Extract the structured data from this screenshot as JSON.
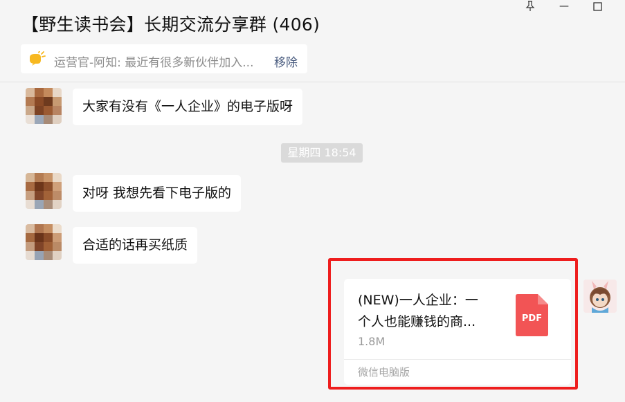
{
  "window": {
    "title": "【野生读书会】长期交流分享群 (406)",
    "controls": {
      "pin_icon": "pin-icon",
      "minimize_glyph": "—",
      "maximize_glyph": "☐"
    }
  },
  "notice": {
    "icon": "announcement-icon",
    "text": "运营官-阿知: 最近有很多新伙伴加入...",
    "action": "移除"
  },
  "messages": [
    {
      "type": "text",
      "from": "other",
      "text": "大家有没有《一人企业》的电子版呀"
    },
    {
      "type": "time",
      "text": "星期四 18:54"
    },
    {
      "type": "text",
      "from": "other",
      "text": "对呀 我想先看下电子版的"
    },
    {
      "type": "text",
      "from": "other",
      "text": "合适的话再买纸质"
    },
    {
      "type": "file",
      "from": "self",
      "name_line1": "(NEW)一人企业：一",
      "name_line2": "个人也能赚钱的商...",
      "size": "1.8M",
      "file_type": "PDF",
      "source": "微信电脑版"
    }
  ],
  "colors": {
    "background": "#f5f5f5",
    "bubble": "#ffffff",
    "highlight_frame": "#ee1d1d",
    "pdf_icon": "#f25455",
    "link": "#4b5d80"
  }
}
